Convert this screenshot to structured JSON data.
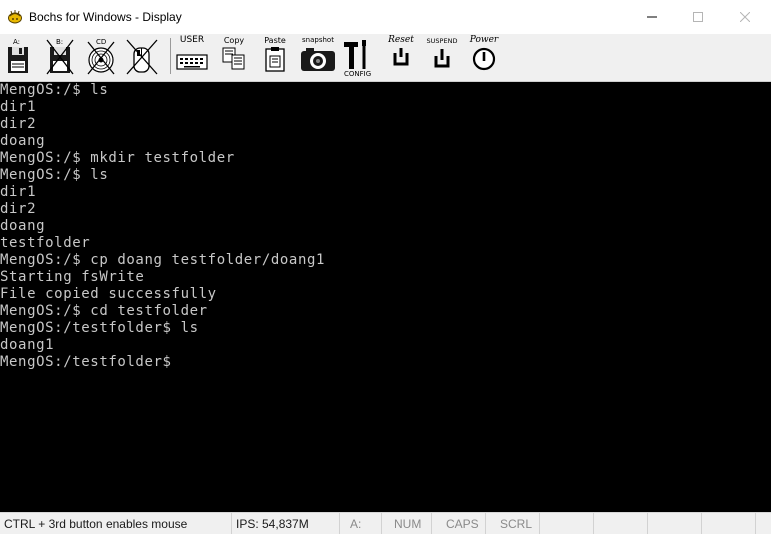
{
  "window": {
    "title": "Bochs for Windows - Display"
  },
  "toolbar": {
    "buttons": [
      {
        "label": "A:",
        "icon": "floppy-a-icon"
      },
      {
        "label": "B:",
        "icon": "floppy-b-icon"
      },
      {
        "label": "CD",
        "icon": "cdrom-icon"
      },
      {
        "label": "",
        "icon": "mouse-capture-icon"
      },
      {
        "label": "USER",
        "icon": "user-keyboard-icon"
      },
      {
        "label": "Copy",
        "icon": "copy-icon"
      },
      {
        "label": "Paste",
        "icon": "paste-icon"
      },
      {
        "label": "snapshot",
        "icon": "snapshot-icon"
      },
      {
        "label": "CONFIG",
        "icon": "config-icon"
      },
      {
        "label": "Reset",
        "icon": "reset-icon"
      },
      {
        "label": "SUSPEND",
        "icon": "suspend-icon"
      },
      {
        "label": "Power",
        "icon": "power-icon"
      }
    ]
  },
  "console": {
    "lines": [
      "MengOS:/$ ls",
      "dir1",
      "dir2",
      "doang",
      "MengOS:/$ mkdir testfolder",
      "MengOS:/$ ls",
      "dir1",
      "dir2",
      "doang",
      "testfolder",
      "MengOS:/$ cp doang testfolder/doang1",
      "Starting fsWrite",
      "File copied successfully",
      "MengOS:/$ cd testfolder",
      "MengOS:/testfolder$ ls",
      "doang1",
      "MengOS:/testfolder$"
    ],
    "text_color": "#c8c8c8",
    "background": "#000000"
  },
  "statusbar": {
    "mouse_hint": "CTRL + 3rd button enables mouse",
    "ips": "IPS: 54,837M",
    "drive": "A:",
    "num": "NUM",
    "caps": "CAPS",
    "scrl": "SCRL"
  }
}
